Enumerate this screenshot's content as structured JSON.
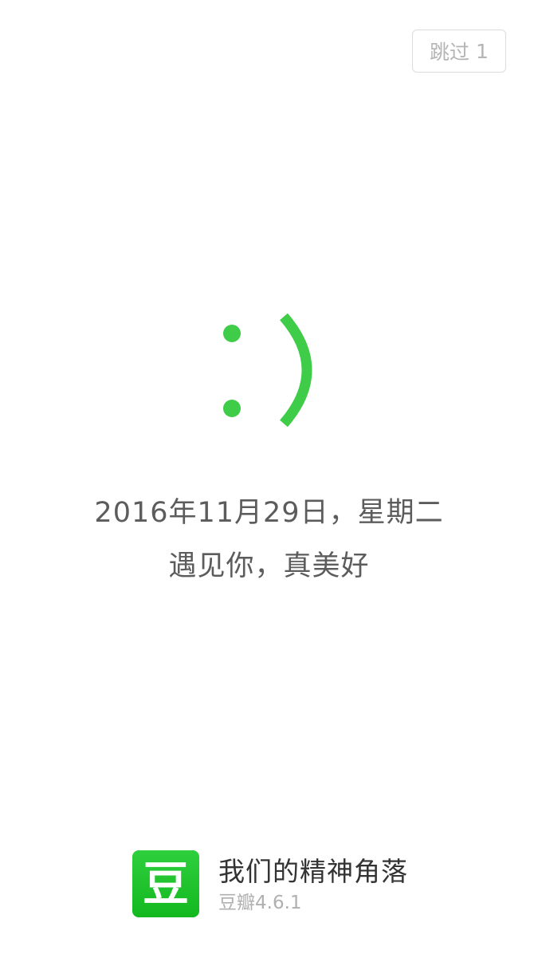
{
  "skip_button": {
    "label": "跳过",
    "countdown": "1"
  },
  "smiley": {
    "icon": "smiley-emoticon-icon",
    "color": "#3fcc48"
  },
  "message": {
    "date_line": "2016年11月29日，星期二",
    "greeting": "遇见你，真美好"
  },
  "brand": {
    "logo_char": "豆",
    "logo_color": "#1ec22c",
    "slogan": "我们的精神角落",
    "version": "豆瓣4.6.1"
  }
}
